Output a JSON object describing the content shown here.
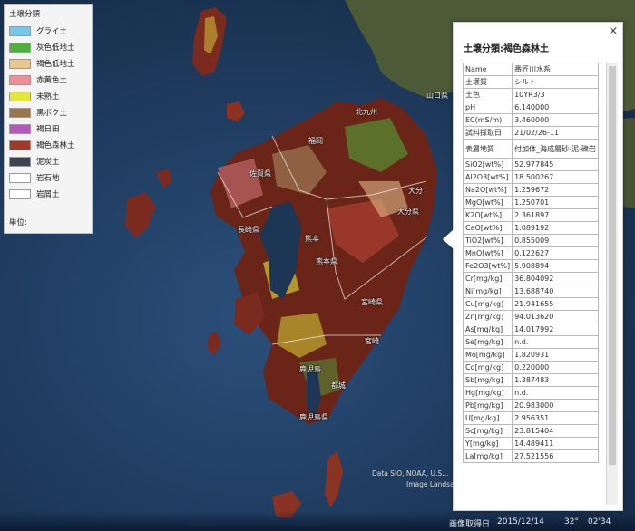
{
  "legend": {
    "title": "土壌分類",
    "items": [
      {
        "label": "グライ土",
        "color": "#76c8e8"
      },
      {
        "label": "灰色低地土",
        "color": "#4fb03b"
      },
      {
        "label": "褐色低地土",
        "color": "#e9c58f"
      },
      {
        "label": "赤黄色土",
        "color": "#ef8f97"
      },
      {
        "label": "未熟土",
        "color": "#e6e63a"
      },
      {
        "label": "黒ボク土",
        "color": "#9b7550"
      },
      {
        "label": "褐日田",
        "color": "#b459b4"
      },
      {
        "label": "褐色森林土",
        "color": "#9e3a2c"
      },
      {
        "label": "泥炭土",
        "color": "#3d4450"
      },
      {
        "label": "岩石地",
        "color": "#ffffff"
      },
      {
        "label": "岩屑土",
        "color": "#ffffff"
      }
    ],
    "unit_label": "単位:"
  },
  "panel": {
    "title": "土壌分類:褐色森林土",
    "close_label": "×",
    "rows": [
      {
        "k": "Name",
        "v": "番匠川水系"
      },
      {
        "k": "土壌質",
        "v": "シルト"
      },
      {
        "k": "土色",
        "v": "10YR3/3"
      },
      {
        "k": "pH",
        "v": "6.140000"
      },
      {
        "k": "EC(mS/m)",
        "v": "3.460000"
      },
      {
        "k": "試料採取日",
        "v": "21/02/26-11"
      },
      {
        "k": "表層地質",
        "v": "付加体_海成層砂-泥-礫岩"
      },
      {
        "k": "SiO2[wt%]",
        "v": "52.977845"
      },
      {
        "k": "Al2O3[wt%]",
        "v": "18.500267"
      },
      {
        "k": "Na2O[wt%]",
        "v": "1.259672"
      },
      {
        "k": "MgO[wt%]",
        "v": "1.250701"
      },
      {
        "k": "K2O[wt%]",
        "v": "2.361897"
      },
      {
        "k": "CaO[wt%]",
        "v": "1.089192"
      },
      {
        "k": "TiO2[wt%]",
        "v": "0.855009"
      },
      {
        "k": "MnO[wt%]",
        "v": "0.122627"
      },
      {
        "k": "Fe2O3[wt%]",
        "v": "5.908894"
      },
      {
        "k": "Cr[mg/kg]",
        "v": "36.804092"
      },
      {
        "k": "Ni[mg/kg]",
        "v": "13.688740"
      },
      {
        "k": "Cu[mg/kg]",
        "v": "21.941655"
      },
      {
        "k": "Zn[mg/kg]",
        "v": "94.013620"
      },
      {
        "k": "As[mg/kg]",
        "v": "14.017992"
      },
      {
        "k": "Se[mg/kg]",
        "v": "n.d."
      },
      {
        "k": "Mo[mg/kg]",
        "v": "1.820931"
      },
      {
        "k": "Cd[mg/kg]",
        "v": "0.220000"
      },
      {
        "k": "Sb[mg/kg]",
        "v": "1.387483"
      },
      {
        "k": "Hg[mg/kg]",
        "v": "n.d."
      },
      {
        "k": "Pb[mg/kg]",
        "v": "20.983000"
      },
      {
        "k": "U[mg/kg]",
        "v": "2.956351"
      },
      {
        "k": "Sc[mg/kg]",
        "v": "23.815404"
      },
      {
        "k": "Y[mg/kg]",
        "v": "14.489411"
      },
      {
        "k": "La[mg/kg]",
        "v": "27.521556"
      }
    ]
  },
  "map": {
    "labels": {
      "kita": "北九州",
      "fukuoka": "福岡",
      "saga": "佐賀県",
      "nagasaki": "長崎県",
      "kumamoto_city": "熊本",
      "kumamoto": "熊本県",
      "oita": "大分県",
      "oita_city": "大分",
      "miyazaki": "宮崎県",
      "miyazaki_city": "宮崎",
      "kagoshima": "鹿児島",
      "kagoshima_pref": "鹿児島県",
      "miyakonojo": "都城",
      "yamaguchi": "山口県"
    },
    "attribution": "Data SIO, NOAA, U.S...",
    "attribution2": "Image Landsat"
  },
  "statusbar": {
    "date_label": "画像取得日",
    "date": "2015/12/14",
    "lat": "32°",
    "coord_tail": "02'34"
  },
  "colors": {
    "sea": "#1f3b60",
    "land_dark": "#5a1f16",
    "forest_red": "#9e3a2c"
  }
}
